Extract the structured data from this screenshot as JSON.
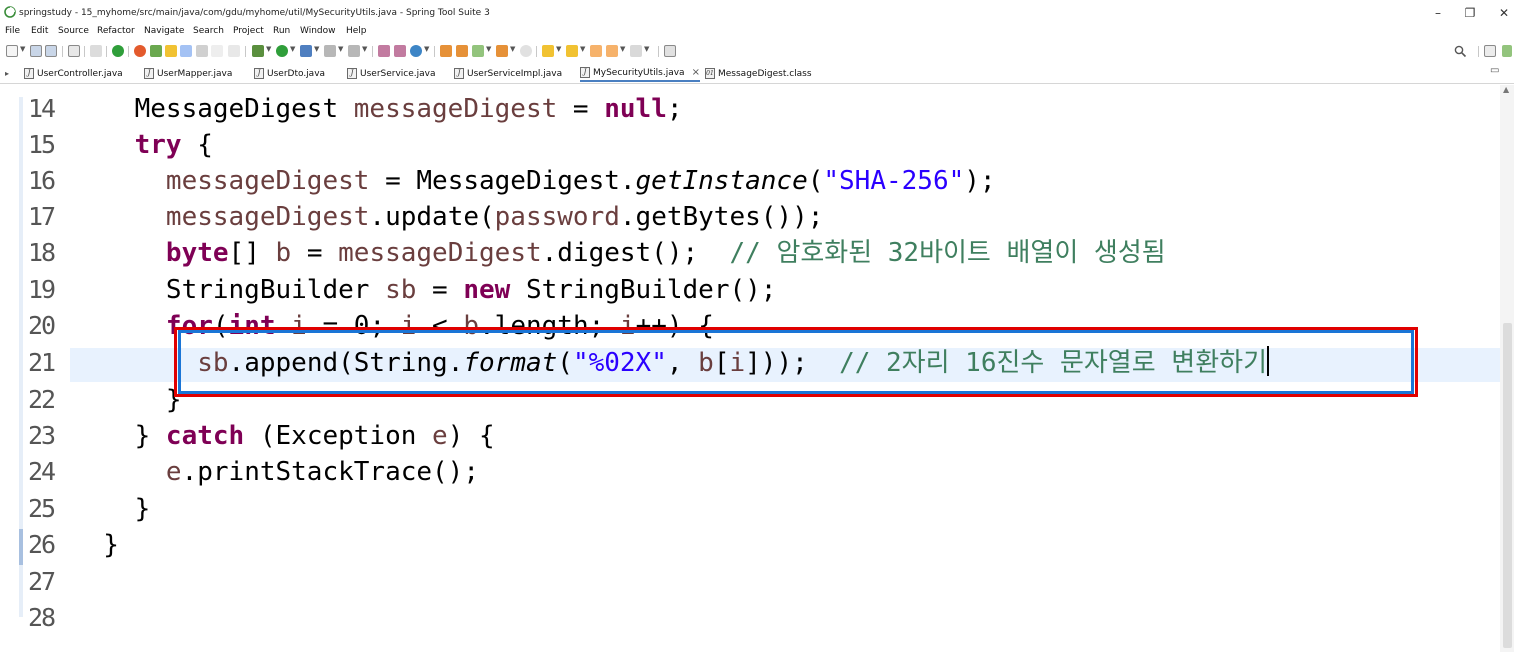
{
  "window": {
    "title": "springstudy - 15_myhome/src/main/java/com/gdu/myhome/util/MySecurityUtils.java - Spring Tool Suite 3",
    "minimize_glyph": "–",
    "restore_glyph": "❐",
    "close_glyph": "✕"
  },
  "menu": [
    "File",
    "Edit",
    "Source",
    "Refactor",
    "Navigate",
    "Search",
    "Project",
    "Run",
    "Window",
    "Help"
  ],
  "tabs": [
    {
      "label": "UserController.java"
    },
    {
      "label": "UserMapper.java"
    },
    {
      "label": "UserDto.java"
    },
    {
      "label": "UserService.java"
    },
    {
      "label": "UserServiceImpl.java"
    },
    {
      "label": "MySecurityUtils.java",
      "active": true
    },
    {
      "label": "MessageDigest.class"
    }
  ],
  "tab_close_glyph": "×",
  "editor": {
    "lines": [
      {
        "num": "14",
        "t": [
          [
            "",
            "    MessageDigest "
          ],
          [
            "var",
            "messageDigest"
          ],
          [
            "",
            " = "
          ],
          [
            "kw",
            "null"
          ],
          [
            "",
            ";"
          ]
        ]
      },
      {
        "num": "15",
        "t": [
          [
            "",
            "    "
          ],
          [
            "kw",
            "try"
          ],
          [
            "",
            " {"
          ]
        ]
      },
      {
        "num": "16",
        "t": [
          [
            "",
            "      "
          ],
          [
            "var",
            "messageDigest"
          ],
          [
            "",
            " = MessageDigest."
          ],
          [
            "it",
            "getInstance"
          ],
          [
            "",
            "("
          ],
          [
            "str",
            "\"SHA-256\""
          ],
          [
            "",
            ");"
          ]
        ]
      },
      {
        "num": "17",
        "t": [
          [
            "",
            "      "
          ],
          [
            "var",
            "messageDigest"
          ],
          [
            "",
            ".update("
          ],
          [
            "var",
            "password"
          ],
          [
            "",
            ".getBytes());"
          ]
        ]
      },
      {
        "num": "18",
        "t": [
          [
            "",
            "      "
          ],
          [
            "kw",
            "byte"
          ],
          [
            "",
            "[] "
          ],
          [
            "var",
            "b"
          ],
          [
            "",
            " = "
          ],
          [
            "var",
            "messageDigest"
          ],
          [
            "",
            ".digest();  "
          ],
          [
            "cm",
            "// 암호화된 32바이트 배열이 생성됨"
          ]
        ]
      },
      {
        "num": "19",
        "t": [
          [
            "",
            "      StringBuilder "
          ],
          [
            "var",
            "sb"
          ],
          [
            "",
            " = "
          ],
          [
            "kw",
            "new"
          ],
          [
            "",
            " StringBuilder();"
          ]
        ]
      },
      {
        "num": "20",
        "t": [
          [
            "",
            "      "
          ],
          [
            "kw",
            "for"
          ],
          [
            "",
            "("
          ],
          [
            "kw",
            "int"
          ],
          [
            "",
            " "
          ],
          [
            "var",
            "i"
          ],
          [
            "",
            " = 0; "
          ],
          [
            "var",
            "i"
          ],
          [
            "",
            " < "
          ],
          [
            "var",
            "b"
          ],
          [
            "",
            ".length; "
          ],
          [
            "var",
            "i"
          ],
          [
            "",
            "++) {"
          ]
        ]
      },
      {
        "num": "21",
        "t": [
          [
            "",
            "        "
          ],
          [
            "var",
            "sb"
          ],
          [
            "",
            ".append(String."
          ],
          [
            "it",
            "format"
          ],
          [
            "",
            "("
          ],
          [
            "str",
            "\"%02X\""
          ],
          [
            "",
            ", "
          ],
          [
            "var",
            "b"
          ],
          [
            "",
            "["
          ],
          [
            "var",
            "i"
          ],
          [
            "",
            "]));  "
          ],
          [
            "cm",
            "// 2자리 16진수 문자열로 변환하기"
          ]
        ],
        "caret": true
      },
      {
        "num": "22",
        "t": [
          [
            "",
            "      }"
          ]
        ]
      },
      {
        "num": "23",
        "t": [
          [
            "",
            "    } "
          ],
          [
            "kw",
            "catch"
          ],
          [
            "",
            " (Exception "
          ],
          [
            "var",
            "e"
          ],
          [
            "",
            ") {"
          ]
        ]
      },
      {
        "num": "24",
        "t": [
          [
            "",
            "      "
          ],
          [
            "var",
            "e"
          ],
          [
            "",
            ".printStackTrace();"
          ]
        ]
      },
      {
        "num": "25",
        "t": [
          [
            "",
            "    }"
          ]
        ]
      },
      {
        "num": "26",
        "t": [
          [
            "",
            "  }"
          ]
        ]
      },
      {
        "num": "27",
        "t": []
      },
      {
        "num": "28",
        "t": []
      }
    ]
  },
  "colors": {
    "keyword": "#7f0055",
    "string": "#2a00ff",
    "comment": "#3f7f5f",
    "variable": "#6a3e3e",
    "current_line": "#e8f2fe",
    "annotation_red": "#e00000",
    "annotation_blue": "#1a75d6"
  }
}
